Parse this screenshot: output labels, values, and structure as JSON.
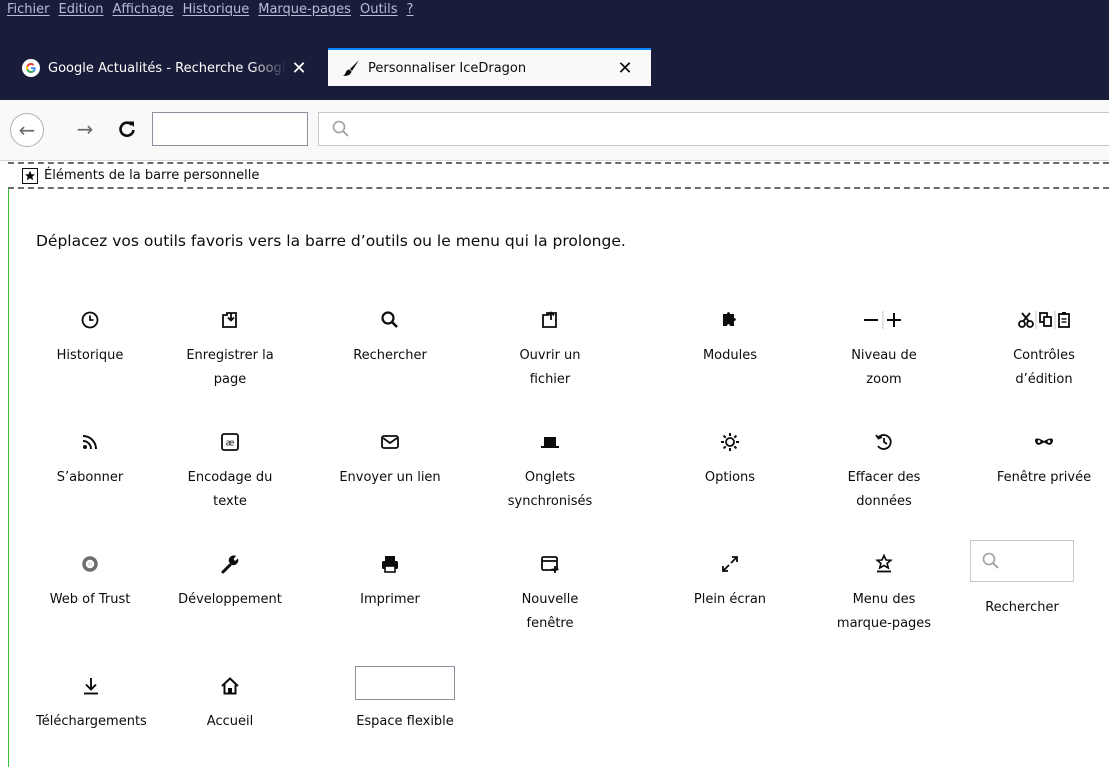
{
  "menubar": {
    "items": [
      {
        "label": "Fichier"
      },
      {
        "label": "Edition"
      },
      {
        "label": "Affichage"
      },
      {
        "label": "Historique"
      },
      {
        "label": "Marque-pages"
      },
      {
        "label": "Outils"
      },
      {
        "label": "?"
      }
    ]
  },
  "tabs": [
    {
      "title": "Google Actualités - Recherche Google",
      "icon": "google-icon",
      "active": false
    },
    {
      "title": "Personnaliser IceDragon",
      "icon": "paintbrush-icon",
      "active": true
    }
  ],
  "tab_close_glyph": "✕",
  "navbar": {
    "url_value": "",
    "search_placeholder": ""
  },
  "perso_bar": {
    "label": "Éléments de la barre personnelle",
    "icon": "star-box-icon"
  },
  "palette": {
    "hint": "Déplacez vos outils favoris vers la barre d’outils ou le menu qui la prolonge.",
    "items": [
      {
        "label1": "Historique",
        "label2": "",
        "icon": "history-clock-icon"
      },
      {
        "label1": "Enregistrer la",
        "label2": "page",
        "icon": "save-page-icon"
      },
      {
        "label1": "Rechercher",
        "label2": "",
        "icon": "search-icon"
      },
      {
        "label1": "Ouvrir un",
        "label2": "fichier",
        "icon": "open-file-icon"
      },
      {
        "label1": "Modules",
        "label2": "",
        "icon": "puzzle-icon"
      },
      {
        "label1": "Niveau de",
        "label2": "zoom",
        "icon": "zoom-controls-icon"
      },
      {
        "label1": "Contrôles",
        "label2": "d’édition",
        "icon": "edit-controls-icon"
      },
      {
        "label1": "S’abonner",
        "label2": "",
        "icon": "feed-icon"
      },
      {
        "label1": "Encodage du",
        "label2": "texte",
        "icon": "encoding-icon"
      },
      {
        "label1": "Envoyer un lien",
        "label2": "",
        "icon": "mail-icon"
      },
      {
        "label1": "Onglets",
        "label2": "synchronisés",
        "icon": "synced-tabs-icon"
      },
      {
        "label1": "Options",
        "label2": "",
        "icon": "gear-icon"
      },
      {
        "label1": "Effacer des",
        "label2": "données",
        "icon": "forget-history-icon"
      },
      {
        "label1": "Fenêtre privée",
        "label2": "",
        "icon": "private-mask-icon"
      },
      {
        "label1": "Web of Trust",
        "label2": "",
        "icon": "wot-ring-icon"
      },
      {
        "label1": "Développement",
        "label2": "",
        "icon": "wrench-icon"
      },
      {
        "label1": "Imprimer",
        "label2": "",
        "icon": "printer-icon"
      },
      {
        "label1": "Nouvelle",
        "label2": "fenêtre",
        "icon": "new-window-icon"
      },
      {
        "label1": "Plein écran",
        "label2": "",
        "icon": "fullscreen-icon"
      },
      {
        "label1": "Menu des",
        "label2": "marque-pages",
        "icon": "bookmarks-menu-icon"
      },
      {
        "label1": "Rechercher",
        "label2": "",
        "icon": "search-widget"
      },
      {
        "label1": "Téléchargements",
        "label2": "",
        "icon": "download-arrow-icon"
      },
      {
        "label1": "Accueil",
        "label2": "",
        "icon": "home-icon"
      },
      {
        "label1": "Espace flexible",
        "label2": "",
        "icon": "flexible-space"
      }
    ]
  },
  "colors": {
    "chrome_dark": "#1a1d3a",
    "active_tab_accent": "#0a84ff",
    "customize_border": "#34c233"
  }
}
